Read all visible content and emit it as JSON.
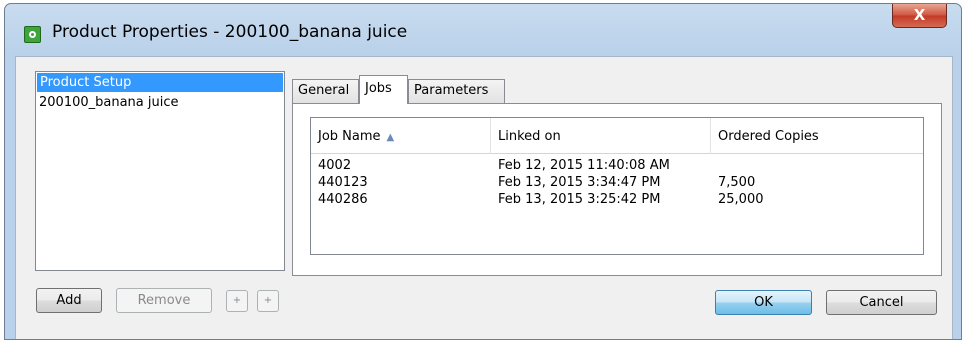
{
  "window": {
    "title": "Product Properties - 200100_banana juice",
    "close_label": "X"
  },
  "product_list": {
    "items": [
      {
        "label": "Product Setup",
        "selected": true
      },
      {
        "label": "200100_banana juice",
        "selected": false
      }
    ]
  },
  "tabs": [
    {
      "label": "General",
      "active": false
    },
    {
      "label": "Jobs",
      "active": true
    },
    {
      "label": "Parameters",
      "active": false
    }
  ],
  "jobs_table": {
    "columns": [
      "Job Name",
      "Linked on",
      "Ordered Copies"
    ],
    "sort_column": "Job Name",
    "sort_direction": "ascending",
    "rows": [
      {
        "job_name": "4002",
        "linked_on": "Feb 12, 2015 11:40:08 AM",
        "ordered_copies": ""
      },
      {
        "job_name": "440123",
        "linked_on": "Feb 13, 2015 3:34:47 PM",
        "ordered_copies": "7,500"
      },
      {
        "job_name": "440286",
        "linked_on": "Feb 13, 2015 3:25:42 PM",
        "ordered_copies": "25,000"
      }
    ]
  },
  "buttons": {
    "add": "Add",
    "remove": "Remove",
    "move_up": "+",
    "move_down": "+",
    "ok": "OK",
    "cancel": "Cancel"
  },
  "colors": {
    "selection": "#3399ff",
    "title_bar": "#b9d1ea",
    "close_button": "#c23a22"
  }
}
